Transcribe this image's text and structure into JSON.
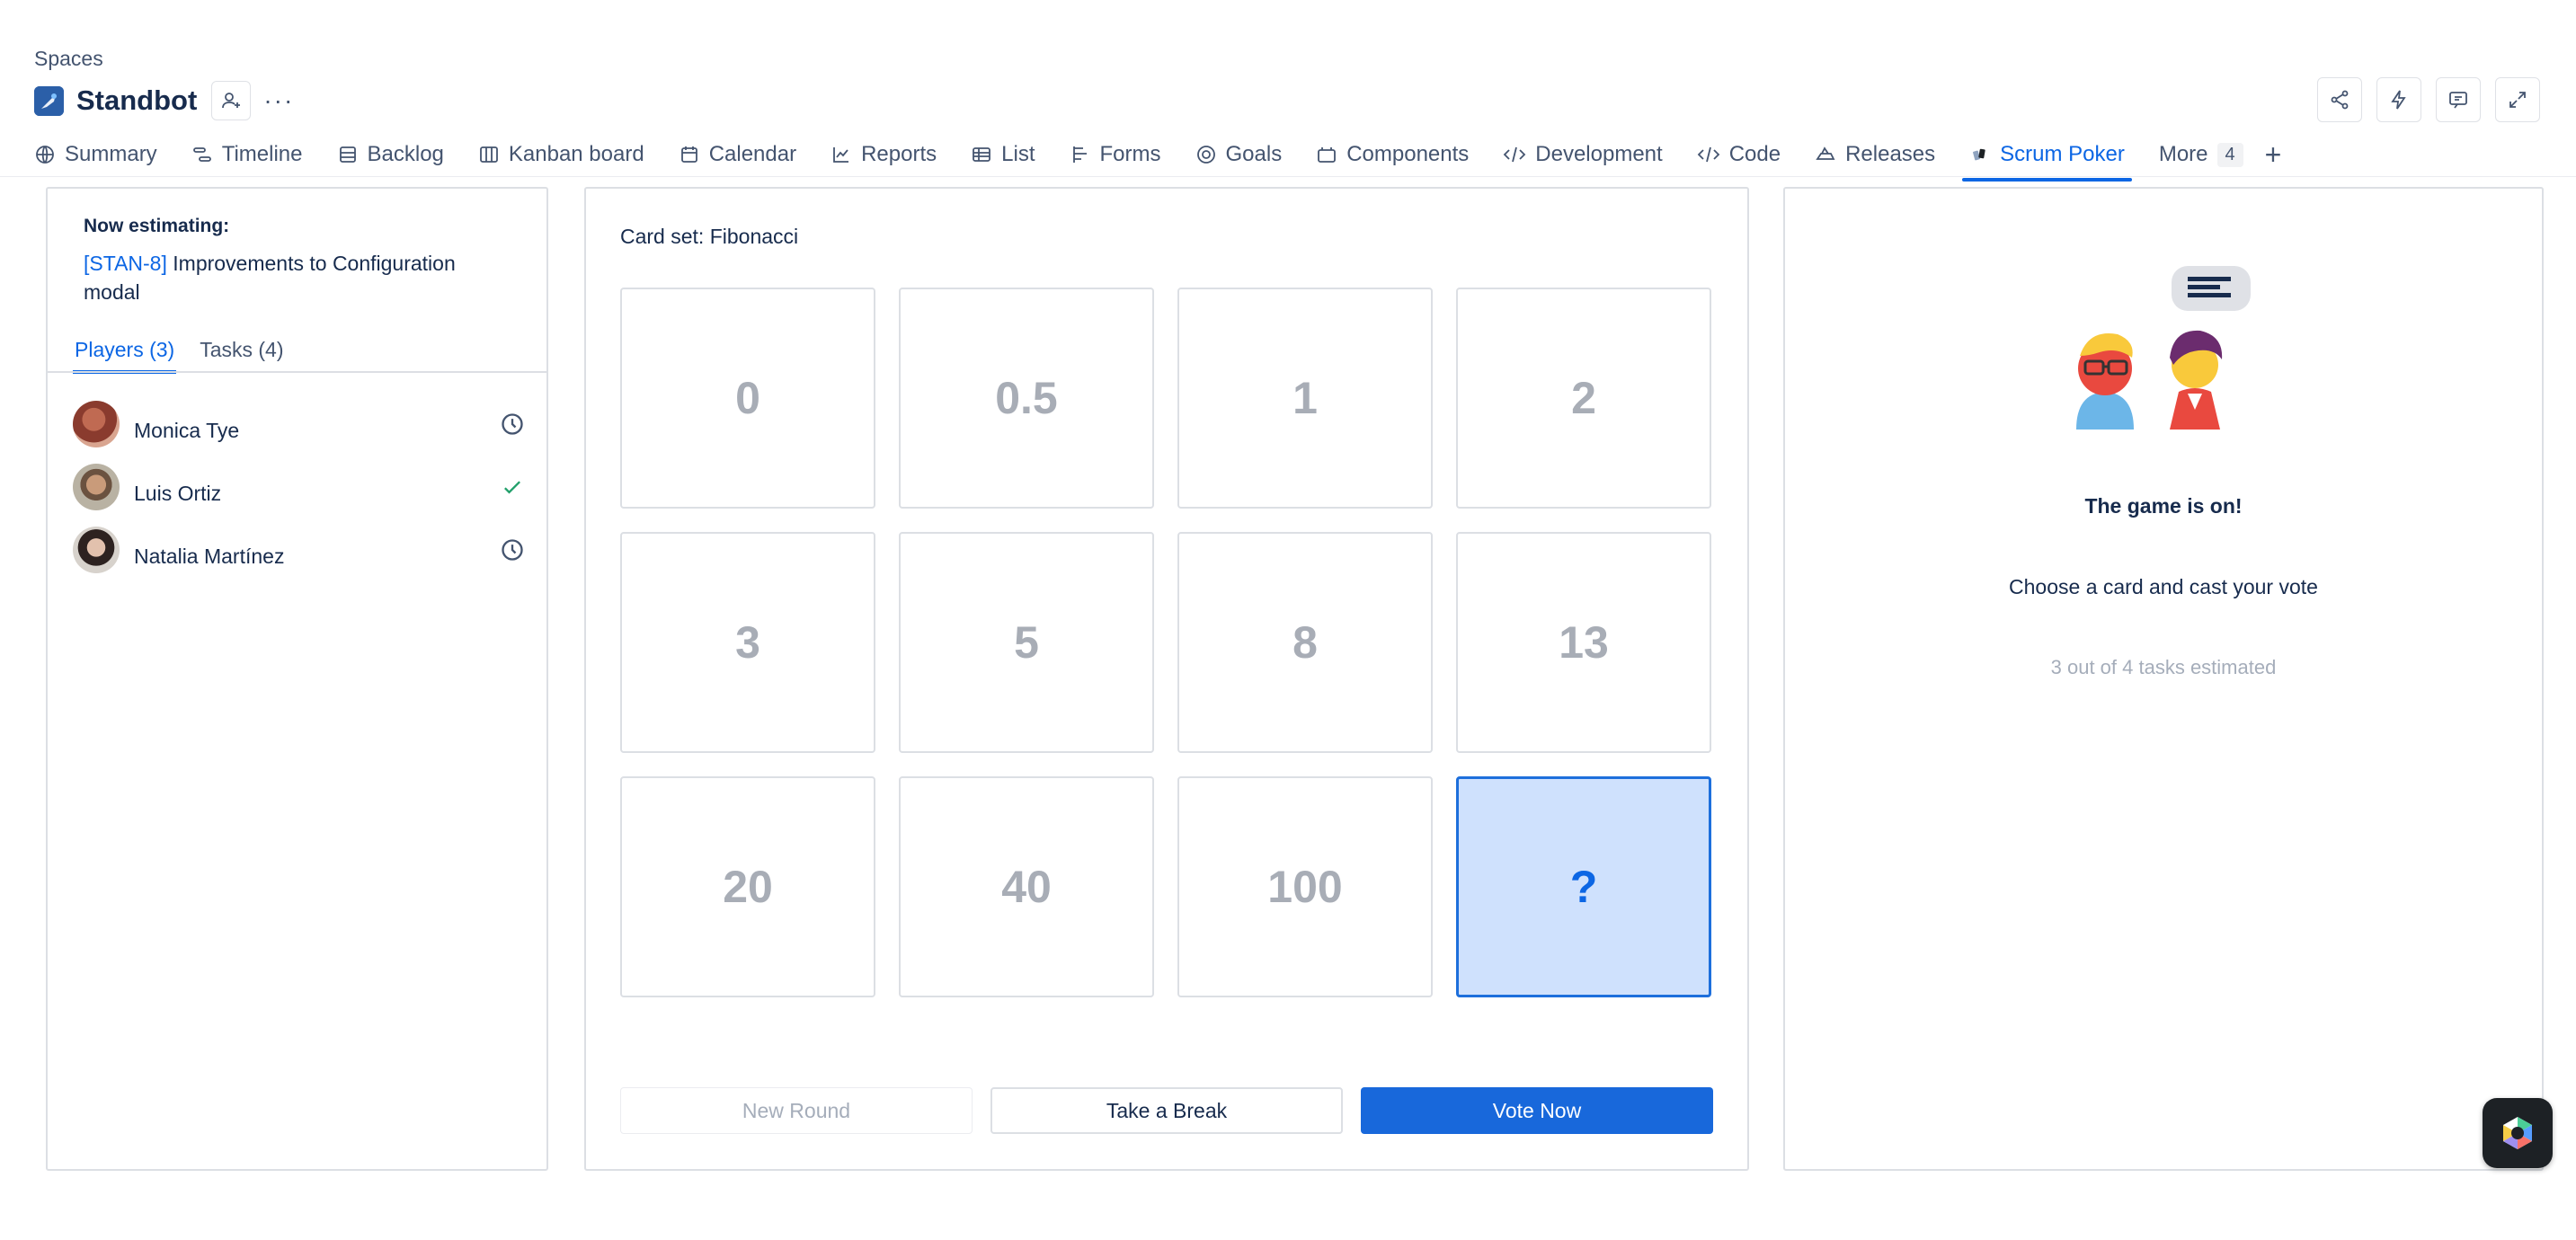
{
  "breadcrumb": "Spaces",
  "space": {
    "title": "Standbot"
  },
  "tabs": [
    {
      "label": "Summary",
      "icon": "globe-icon"
    },
    {
      "label": "Timeline",
      "icon": "timeline-icon"
    },
    {
      "label": "Backlog",
      "icon": "backlog-icon"
    },
    {
      "label": "Kanban board",
      "icon": "board-icon"
    },
    {
      "label": "Calendar",
      "icon": "calendar-icon"
    },
    {
      "label": "Reports",
      "icon": "chart-icon"
    },
    {
      "label": "List",
      "icon": "list-icon"
    },
    {
      "label": "Forms",
      "icon": "forms-icon"
    },
    {
      "label": "Goals",
      "icon": "target-icon"
    },
    {
      "label": "Components",
      "icon": "component-icon"
    },
    {
      "label": "Development",
      "icon": "code-icon"
    },
    {
      "label": "Code",
      "icon": "code-icon"
    },
    {
      "label": "Releases",
      "icon": "ship-icon"
    },
    {
      "label": "Scrum Poker",
      "icon": "poker-icon",
      "active": true
    },
    {
      "label": "More",
      "badge": "4"
    }
  ],
  "left": {
    "now_label": "Now estimating:",
    "task_key": "[STAN-8]",
    "task_title": " Improvements to Configuration modal",
    "players_tab": "Players (3)",
    "tasks_tab": "Tasks (4)",
    "players": [
      {
        "name": "Monica Tye",
        "status": "clock-icon"
      },
      {
        "name": "Luis Ortiz",
        "status": "check-icon"
      },
      {
        "name": "Natalia Martínez",
        "status": "clock-icon"
      }
    ]
  },
  "middle": {
    "card_set": "Card set: Fibonacci",
    "cards": [
      "0",
      "0.5",
      "1",
      "2",
      "3",
      "5",
      "8",
      "13",
      "20",
      "40",
      "100",
      "?"
    ],
    "selected_card": "?",
    "buttons": {
      "new_round": "New Round",
      "take_break": "Take a Break",
      "vote_now": "Vote Now"
    }
  },
  "right": {
    "title": "The game is on!",
    "subtitle": "Choose a card and cast your vote",
    "progress": "3 out of 4 tasks estimated"
  },
  "colors": {
    "accent": "#0c66e4",
    "selected_card_bg": "#cfe1fd",
    "primary_button": "#1868db"
  }
}
